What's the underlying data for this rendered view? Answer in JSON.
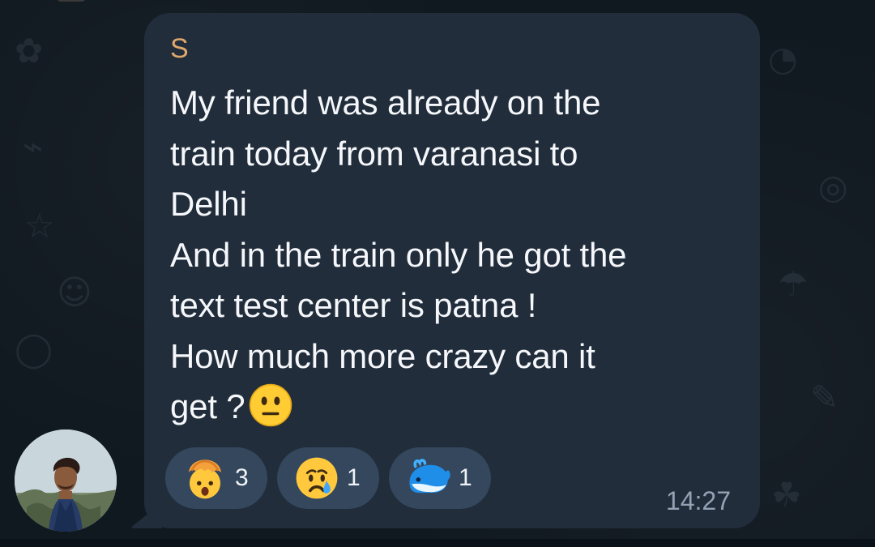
{
  "message": {
    "sender": "S",
    "text": "My friend was already on the\ntrain today from varanasi to\nDelhi\nAnd in the train only he got the\ntext test center is patna !\nHow much more crazy can it\nget ?",
    "trailing_emoji": "neutral-face",
    "time": "14:27"
  },
  "reactions": [
    {
      "icon": "exploding-head-emoji",
      "count": "3"
    },
    {
      "icon": "crying-face-emoji",
      "count": "1"
    },
    {
      "icon": "spouting-whale-emoji",
      "count": "1"
    }
  ],
  "colors": {
    "background": "#101820",
    "bubble": "#212d3b",
    "sender": "#e0a86b",
    "text": "#f5f7fa",
    "reaction_pill": "#34475d",
    "time": "#93a2b4"
  }
}
